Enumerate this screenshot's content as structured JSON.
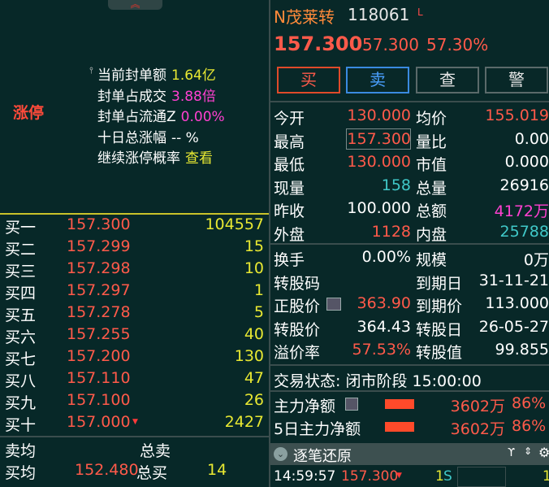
{
  "left": {
    "limit_badge": "涨停",
    "seal": [
      {
        "label": "当前封单额",
        "value": "1.64亿",
        "color": "#e8e832"
      },
      {
        "label": "封单占成交",
        "value": "3.88倍",
        "color": "#ff40d0"
      },
      {
        "label": "封单占流通Z",
        "value": "0.00%",
        "color": "#ff40d0"
      },
      {
        "label": "十日总涨幅",
        "value": "--  %",
        "color": "#ffffff"
      },
      {
        "label": "继续涨停概率",
        "value": "查看",
        "color": "#e8e832"
      }
    ],
    "bids": [
      {
        "label": "买一",
        "price": "157.300",
        "vol": "104557"
      },
      {
        "label": "买二",
        "price": "157.299",
        "vol": "15"
      },
      {
        "label": "买三",
        "price": "157.298",
        "vol": "10"
      },
      {
        "label": "买四",
        "price": "157.297",
        "vol": "1"
      },
      {
        "label": "买五",
        "price": "157.278",
        "vol": "5"
      },
      {
        "label": "买六",
        "price": "157.255",
        "vol": "40"
      },
      {
        "label": "买七",
        "price": "157.200",
        "vol": "130"
      },
      {
        "label": "买八",
        "price": "157.110",
        "vol": "47"
      },
      {
        "label": "买九",
        "price": "157.100",
        "vol": "26"
      },
      {
        "label": "买十",
        "price": "157.000",
        "vol": "2427",
        "arrow": "▼"
      }
    ],
    "sell_avg_label": "卖均",
    "total_sell_label": "总卖",
    "buy_avg_label": "买均",
    "buy_avg_value": "152.480",
    "total_buy_label": "总买",
    "total_buy_value": "14"
  },
  "header": {
    "name": "N茂莱转",
    "code": "118061",
    "flag": "L",
    "price": "157.300",
    "change": "57.300",
    "change_pct": "57.30%"
  },
  "buttons": [
    "买",
    "卖",
    "查",
    "警"
  ],
  "quote": {
    "rows": [
      {
        "l1": "今开",
        "v1": "130.000",
        "c1": "red",
        "l2": "均价",
        "v2": "155.019",
        "c2": "red"
      },
      {
        "l1": "最高",
        "v1": "157.300",
        "c1": "red",
        "l2": "量比",
        "v2": "0.00",
        "c2": "white"
      },
      {
        "l1": "最低",
        "v1": "130.000",
        "c1": "red",
        "l2": "市值",
        "v2": "0.000",
        "c2": "white"
      },
      {
        "l1": "现量",
        "v1": "158",
        "c1": "cyan",
        "l2": "总量",
        "v2": "26916",
        "c2": "white"
      },
      {
        "l1": "昨收",
        "v1": "100.000",
        "c1": "white",
        "l2": "总额",
        "v2": "4172万",
        "c2": "magenta"
      },
      {
        "l1": "外盘",
        "v1": "1128",
        "c1": "red",
        "l2": "内盘",
        "v2": "25788",
        "c2": "cyan"
      }
    ],
    "rows2": [
      {
        "l1": "换手",
        "v1": "0.00%",
        "c1": "white",
        "l2": "规模",
        "v2": "0万",
        "c2": "white"
      },
      {
        "l1": "转股码",
        "v1": "",
        "c1": "white",
        "l2": "到期日",
        "v2": "31-11-21",
        "c2": "white"
      },
      {
        "l1": "正股价",
        "v1": "363.90",
        "c1": "red",
        "l2": "到期价",
        "v2": "113.000",
        "c2": "white"
      },
      {
        "l1": "转股价",
        "v1": "364.43",
        "c1": "white",
        "l2": "转股日",
        "v2": "26-05-27",
        "c2": "white"
      },
      {
        "l1": "溢价率",
        "v1": "57.53%",
        "c1": "red",
        "l2": "转股值",
        "v2": "99.855",
        "c2": "white"
      }
    ]
  },
  "trade_status": "交易状态: 闭市阶段 15:00:00",
  "flows": [
    {
      "label": "主力净额",
      "value": "3602万",
      "pct": "86%"
    },
    {
      "label": "5日主力净额",
      "value": "3602万",
      "pct": "86%"
    }
  ],
  "tick": {
    "title": "逐笔还原",
    "time": "14:59:57",
    "price": "157.300",
    "vol": "1",
    "unit": "S",
    "last": "1"
  }
}
